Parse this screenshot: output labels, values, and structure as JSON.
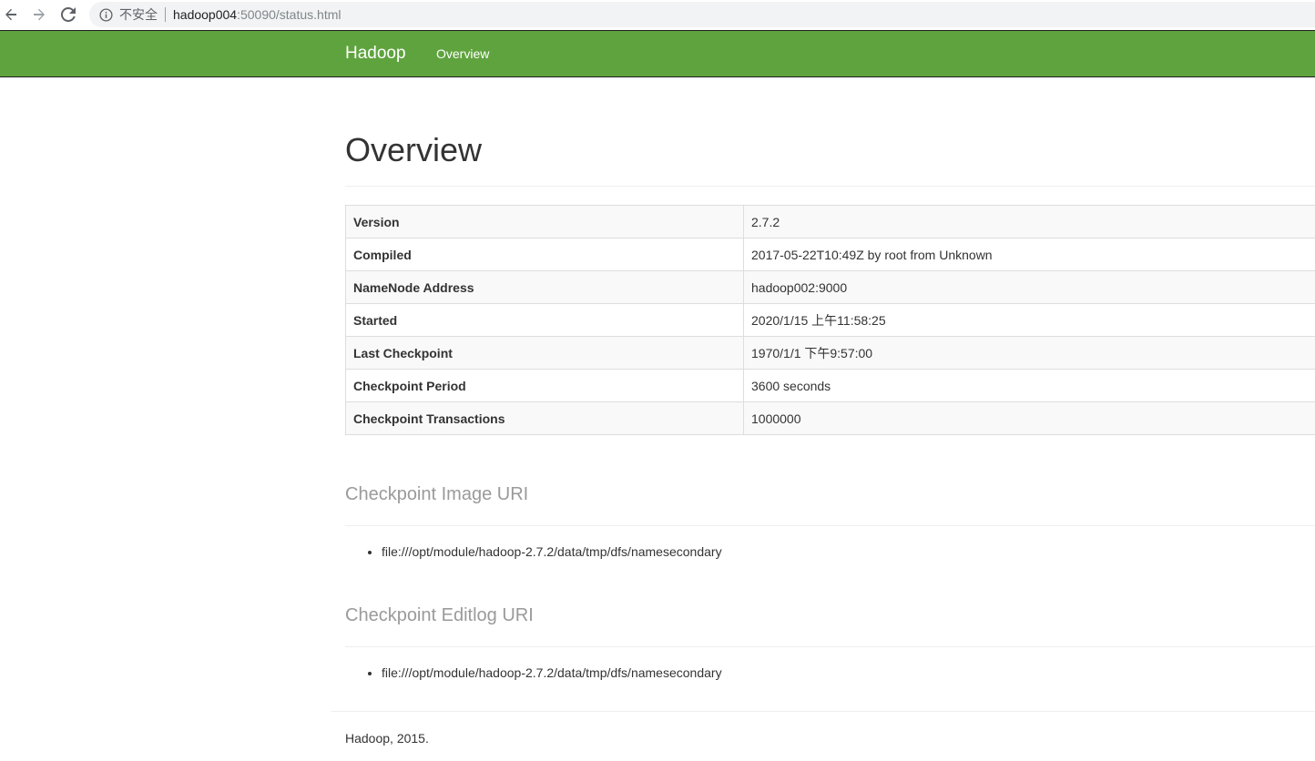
{
  "browser": {
    "insecure_label": "不安全",
    "url_host": "hadoop004",
    "url_path": ":50090/status.html"
  },
  "navbar": {
    "brand": "Hadoop",
    "links": [
      "Overview"
    ],
    "color": "#5fa33e"
  },
  "page": {
    "title": "Overview"
  },
  "overview_table": {
    "rows": [
      {
        "label": "Version",
        "value": "2.7.2"
      },
      {
        "label": "Compiled",
        "value": "2017-05-22T10:49Z by root from Unknown"
      },
      {
        "label": "NameNode Address",
        "value": "hadoop002:9000"
      },
      {
        "label": "Started",
        "value": "2020/1/15 上午11:58:25"
      },
      {
        "label": "Last Checkpoint",
        "value": "1970/1/1 下午9:57:00"
      },
      {
        "label": "Checkpoint Period",
        "value": "3600 seconds"
      },
      {
        "label": "Checkpoint Transactions",
        "value": "1000000"
      }
    ]
  },
  "image_uri": {
    "title": "Checkpoint Image URI",
    "items": [
      "file:///opt/module/hadoop-2.7.2/data/tmp/dfs/namesecondary"
    ]
  },
  "editlog_uri": {
    "title": "Checkpoint Editlog URI",
    "items": [
      "file:///opt/module/hadoop-2.7.2/data/tmp/dfs/namesecondary"
    ]
  },
  "footer": {
    "text": "Hadoop, 2015."
  }
}
